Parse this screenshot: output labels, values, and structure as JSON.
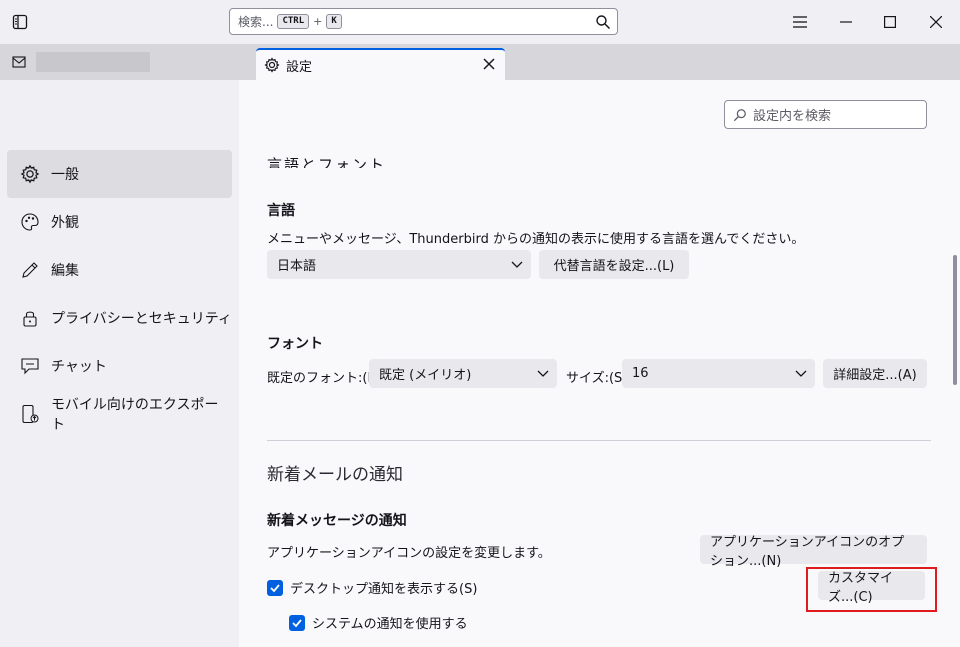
{
  "titlebar": {
    "search_placeholder": "検索...",
    "kbd_ctrl": "CTRL",
    "kbd_plus": "+",
    "kbd_k": "K"
  },
  "tabs": {
    "settings_label": "設定"
  },
  "sidebar": {
    "items": [
      {
        "label": "一般",
        "icon": "gear-icon",
        "selected": true
      },
      {
        "label": "外観",
        "icon": "palette-icon"
      },
      {
        "label": "編集",
        "icon": "pencil-icon"
      },
      {
        "label": "プライバシーとセキュリティ",
        "icon": "lock-icon"
      },
      {
        "label": "チャット",
        "icon": "chat-icon"
      },
      {
        "label": "モバイル向けのエクスポート",
        "icon": "mobile-export-icon"
      }
    ]
  },
  "main": {
    "find_placeholder": "設定内を検索",
    "cut_heading": "言語とフォント",
    "language": {
      "heading": "言語",
      "description": "メニューやメッセージ、Thunderbird からの通知の表示に使用する言語を選んでください。",
      "selected": "日本語",
      "alt_button": "代替言語を設定...(L)"
    },
    "font": {
      "heading": "フォント",
      "default_label": "既定のフォント:(D)",
      "default_value": "既定 (メイリオ)",
      "size_label": "サイズ:(S)",
      "size_value": "16",
      "advanced_button": "詳細設定...(A)"
    },
    "notifications": {
      "section_title": "新着メールの通知",
      "heading": "新着メッセージの通知",
      "app_icon_desc": "アプリケーションアイコンの設定を変更します。",
      "app_icon_button": "アプリケーションアイコンのオプション...(N)",
      "desktop_checkbox": "デスクトップ通知を表示する(S)",
      "customize_button": "カスタマイズ...(C)",
      "system_checkbox": "システムの通知を使用する"
    }
  },
  "colors": {
    "accent": "#0060df",
    "highlight": "#e01b1b"
  }
}
